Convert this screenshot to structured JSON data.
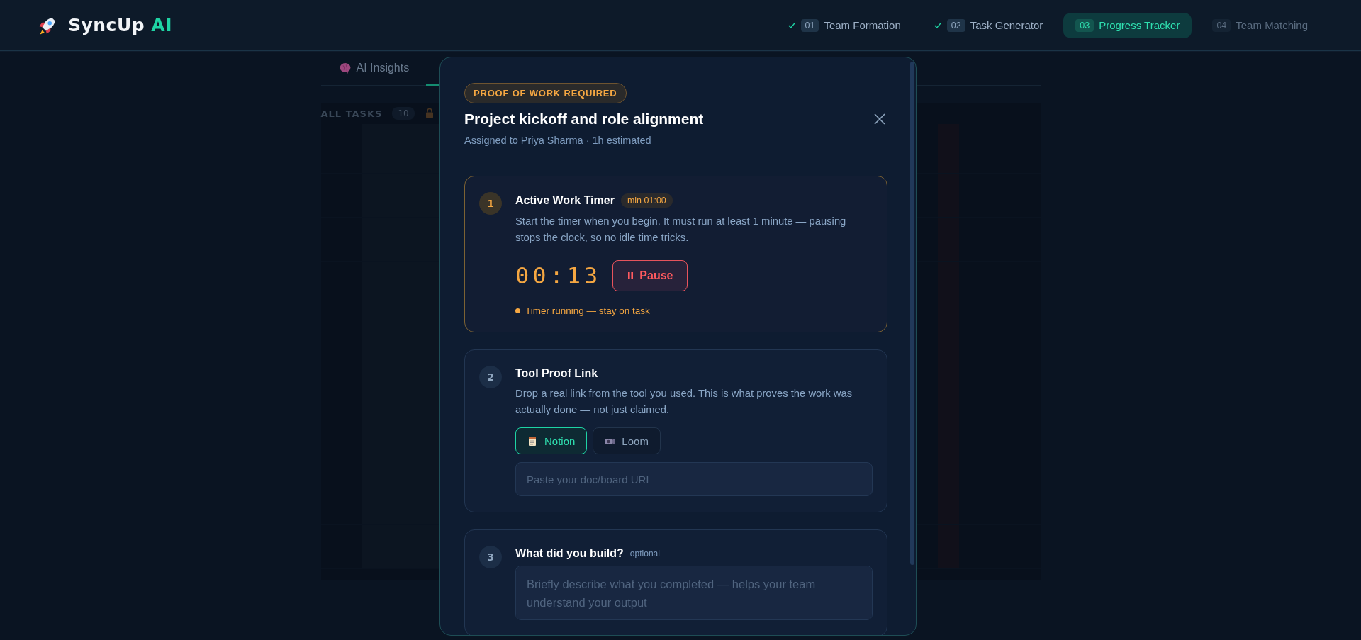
{
  "header": {
    "logo": {
      "name": "SyncUp",
      "accent": "AI"
    },
    "steps": [
      {
        "number": "01",
        "label": "Team Formation",
        "done": true,
        "selected": false
      },
      {
        "number": "02",
        "label": "Task Generator",
        "done": true,
        "selected": false
      },
      {
        "number": "03",
        "label": "Progress Tracker",
        "done": false,
        "selected": true
      },
      {
        "number": "04",
        "label": "Team Matching",
        "done": false,
        "selected": false
      }
    ]
  },
  "background": {
    "tabs": [
      {
        "label": "AI Insights",
        "selected": false
      },
      {
        "selected": true
      }
    ],
    "task_list": {
      "title": "ALL TASKS",
      "count": "10"
    }
  },
  "modal": {
    "badge": "PROOF OF WORK REQUIRED",
    "title": "Project kickoff and role alignment",
    "subtitle": "Assigned to Priya Sharma · 1h estimated",
    "steps": [
      {
        "number": "1",
        "kind": "timer",
        "active": true,
        "title": "Active Work Timer",
        "tag": "min 01:00",
        "description": "Start the timer when you begin. It must run at least 1 minute — pausing stops the clock, so no idle time tricks.",
        "time": "00:13",
        "button": "Pause",
        "running": true,
        "status": "Timer running — stay on task"
      },
      {
        "number": "2",
        "kind": "link",
        "active": false,
        "title": "Tool Proof Link",
        "description": "Drop a real link from the tool you used. This is what proves the work was actually done — not just claimed.",
        "tools": [
          {
            "label": "Notion",
            "selected": true
          },
          {
            "label": "Loom",
            "selected": false
          }
        ],
        "placeholder": "Paste your doc/board URL"
      },
      {
        "number": "3",
        "kind": "text",
        "active": false,
        "title": "What did you build?",
        "note": "optional",
        "placeholder": "Briefly describe what you completed — helps your team understand your output"
      }
    ]
  }
}
